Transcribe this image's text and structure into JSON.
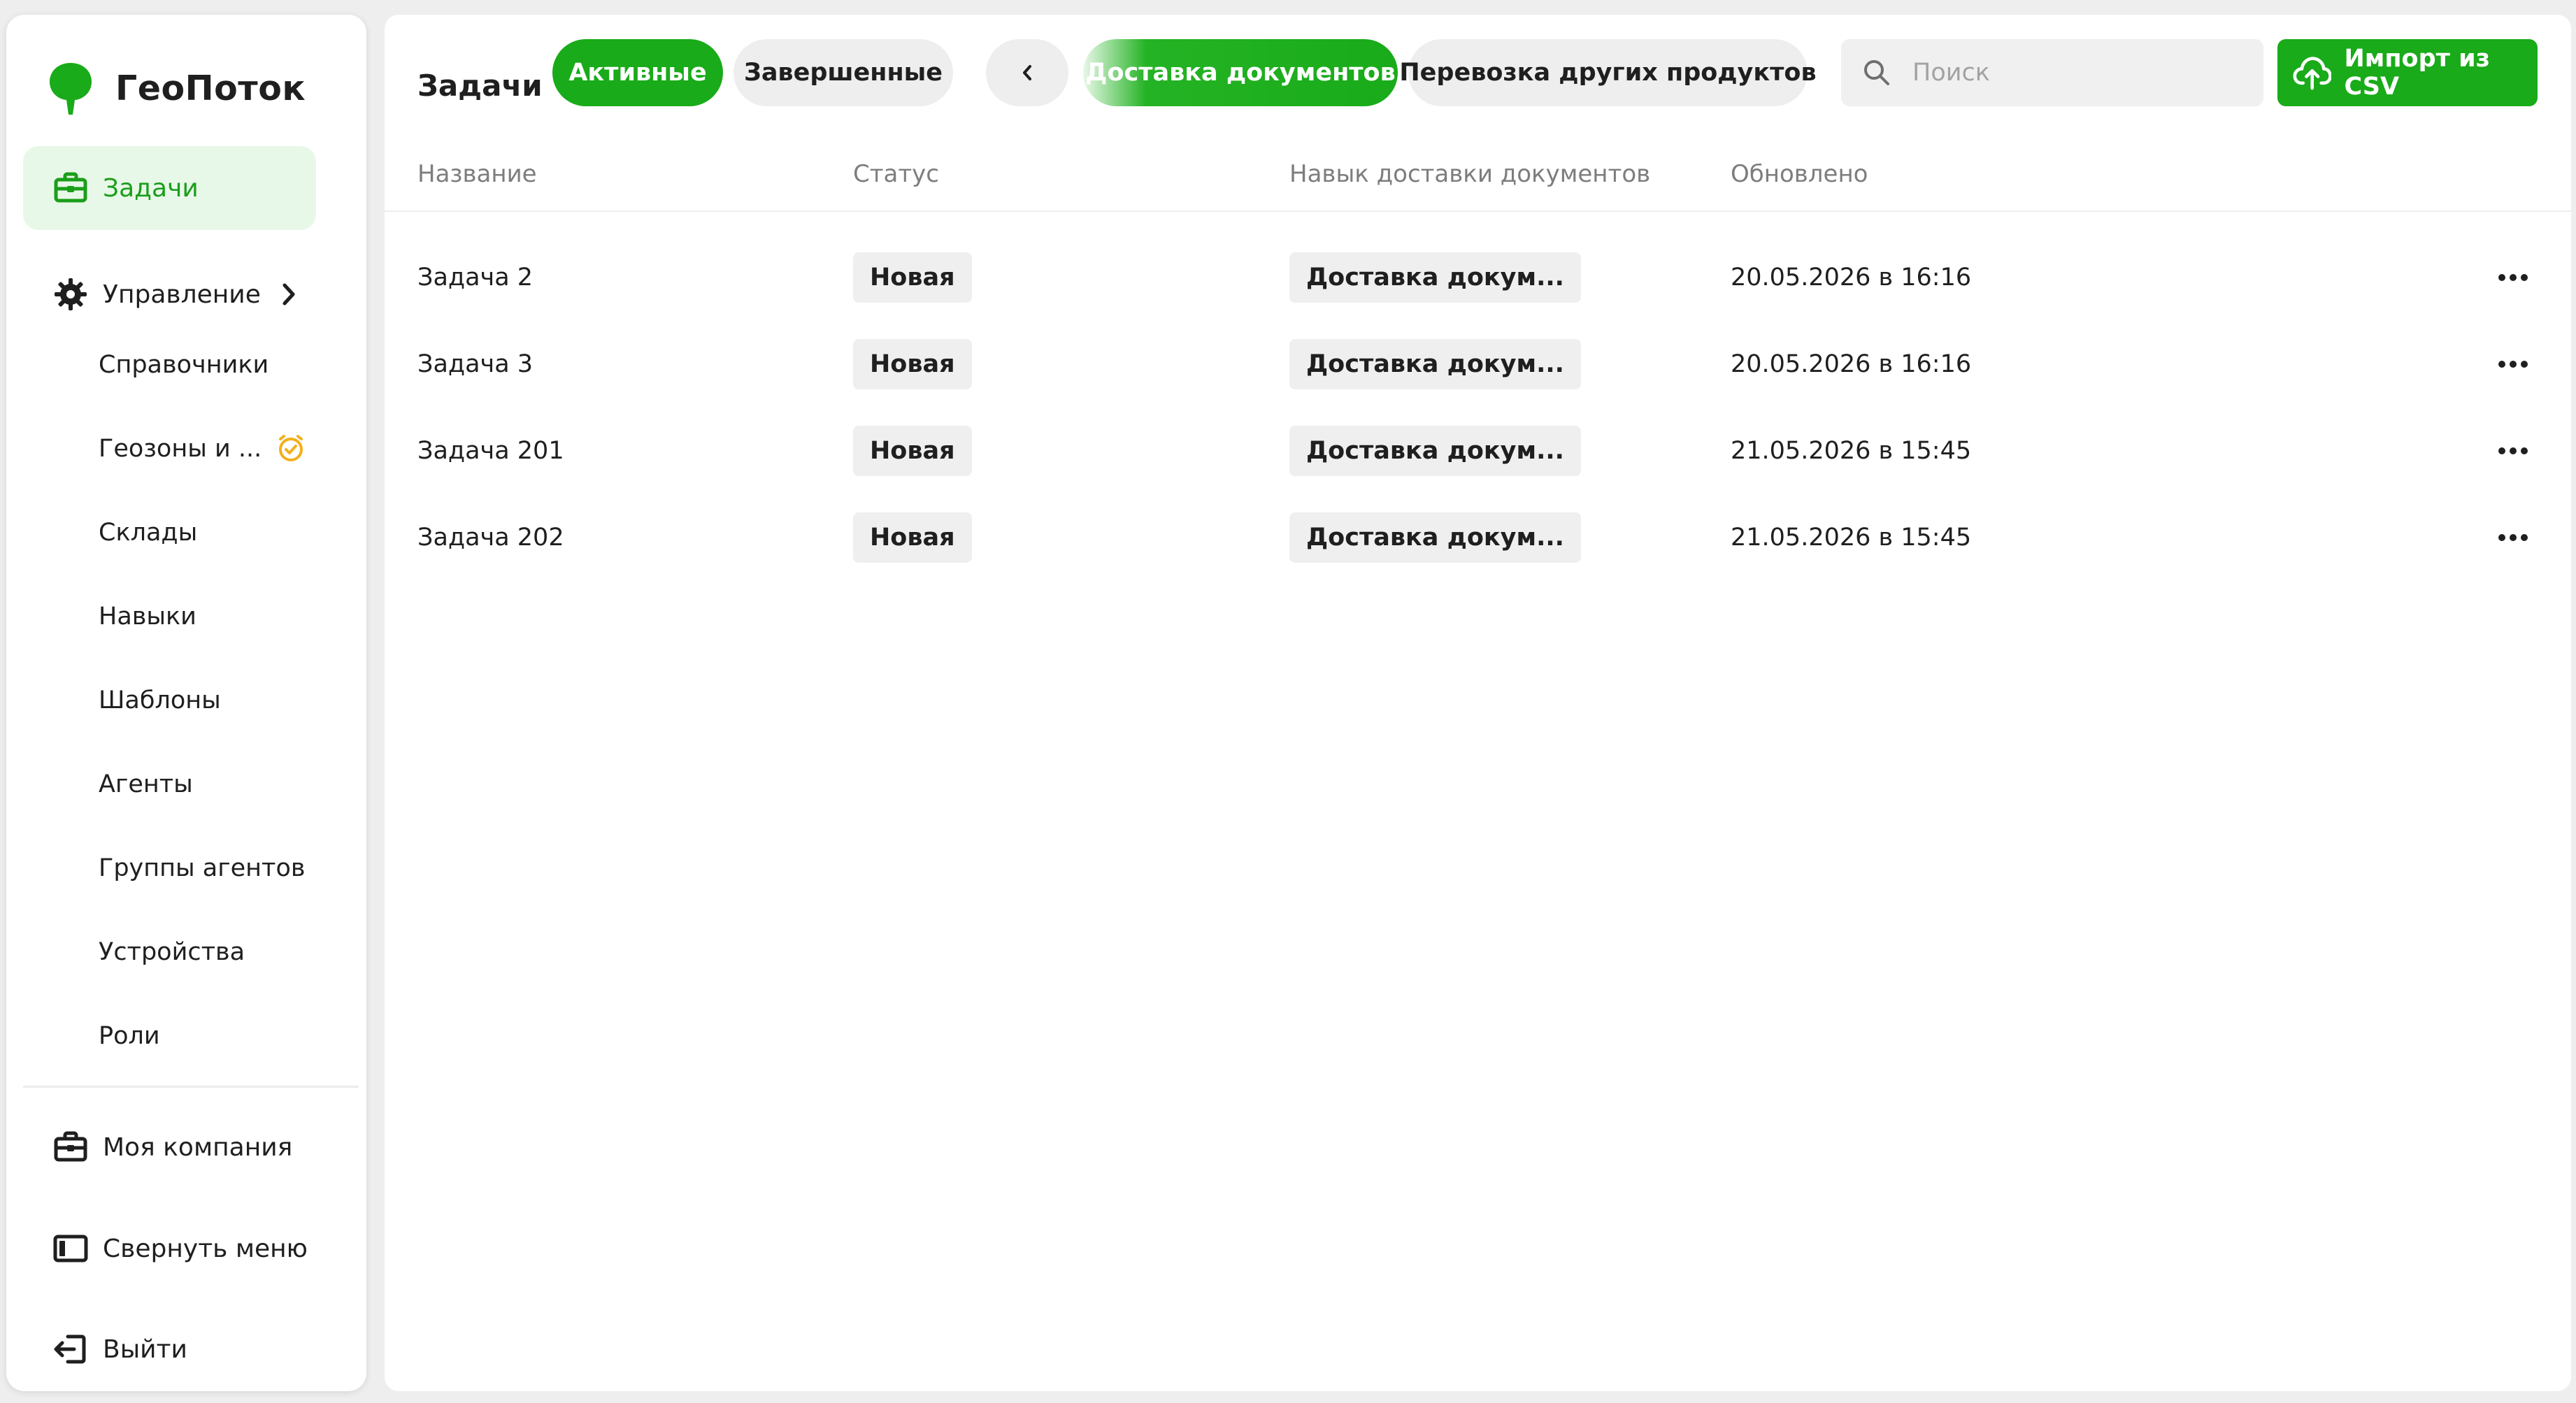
{
  "app": {
    "name": "ГеоПоток",
    "brand_color": "#19ab19",
    "active_bg": "#e8f8e8"
  },
  "sidebar": {
    "items": [
      {
        "label": "Задачи",
        "icon": "briefcase-icon",
        "active": true
      },
      {
        "label": "Управление",
        "icon": "gear-icon",
        "expandable": true
      }
    ],
    "subitems": [
      {
        "label": "Справочники"
      },
      {
        "label": "Геозоны и ...",
        "badge_icon": "clock-check-icon",
        "badge_color": "#f2b01e"
      },
      {
        "label": "Склады"
      },
      {
        "label": "Навыки"
      },
      {
        "label": "Шаблоны"
      },
      {
        "label": "Агенты"
      },
      {
        "label": "Группы агентов"
      },
      {
        "label": "Устройства"
      },
      {
        "label": "Роли"
      }
    ],
    "bottom": [
      {
        "label": "Моя компания",
        "icon": "briefcase-icon"
      },
      {
        "label": "Свернуть меню",
        "icon": "collapse-sidebar-icon"
      },
      {
        "label": "Выйти",
        "icon": "logout-icon"
      }
    ]
  },
  "header": {
    "title": "Задачи",
    "status_tabs": [
      {
        "label": "Активные",
        "selected": true
      },
      {
        "label": "Завершенные",
        "selected": false
      }
    ],
    "scroll_back_icon": "chevron-left-icon",
    "skill_tabs": [
      {
        "label": "Доставка документов",
        "selected": true
      },
      {
        "label": "Перевозка других продуктов",
        "selected": false
      }
    ],
    "search": {
      "placeholder": "Поиск",
      "value": ""
    },
    "import_label": "Импорт из CSV"
  },
  "table": {
    "columns": [
      "Название",
      "Статус",
      "Навык доставки документов",
      "Обновлено"
    ],
    "rows": [
      {
        "name": "Задача 2",
        "status": "Новая",
        "skill": "Доставка докум...",
        "updated": "20.05.2026 в 16:16"
      },
      {
        "name": "Задача 3",
        "status": "Новая",
        "skill": "Доставка докум...",
        "updated": "20.05.2026 в 16:16"
      },
      {
        "name": "Задача 201",
        "status": "Новая",
        "skill": "Доставка докум...",
        "updated": "21.05.2026 в 15:45"
      },
      {
        "name": "Задача 202",
        "status": "Новая",
        "skill": "Доставка докум...",
        "updated": "21.05.2026 в 15:45"
      }
    ]
  }
}
